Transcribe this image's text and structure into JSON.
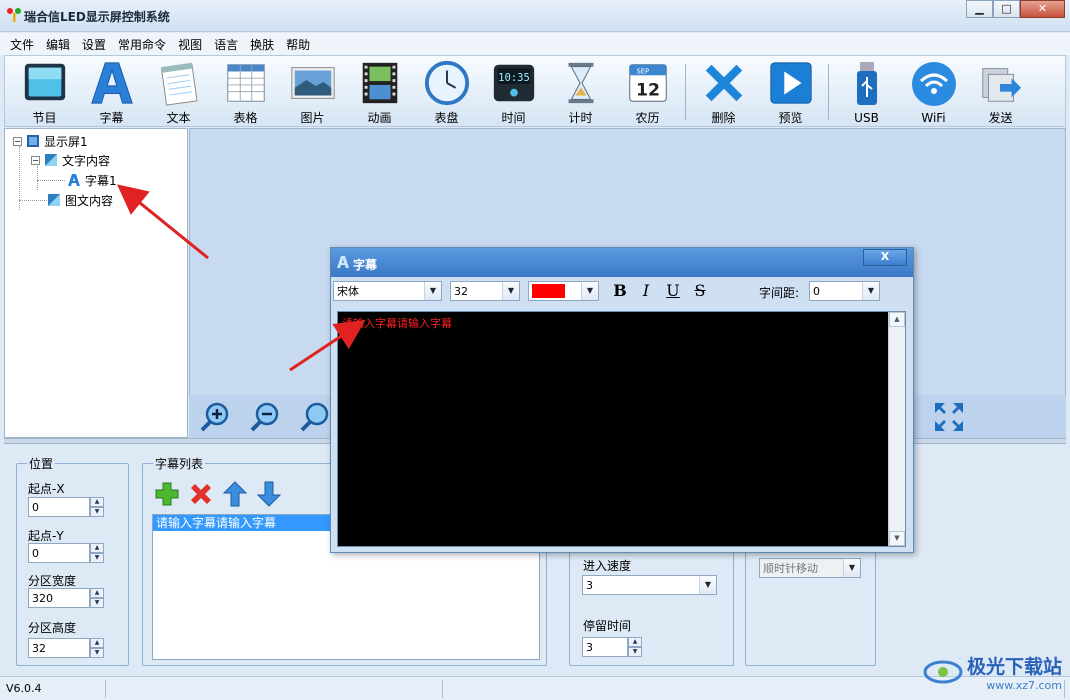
{
  "window": {
    "title": "瑞合信LED显示屏控制系统",
    "min": "▁",
    "max": "□",
    "close": "✕"
  },
  "menu": [
    "文件",
    "编辑",
    "设置",
    "常用命令",
    "视图",
    "语言",
    "换肤",
    "帮助"
  ],
  "toolbar": {
    "program": "节目",
    "subtitle": "字幕",
    "text": "文本",
    "table": "表格",
    "image": "图片",
    "animation": "动画",
    "clock": "表盘",
    "time": "时间",
    "timer": "计时",
    "calendar": "农历",
    "delete": "删除",
    "preview": "预览",
    "usb": "USB",
    "wifi": "WiFi",
    "send": "发送",
    "clock_digits": "10:35",
    "cal_month": "SEP",
    "cal_day": "12"
  },
  "tree": {
    "root": "显示屏1",
    "group1": "文字内容",
    "item1": "字幕1",
    "group2": "图文内容",
    "minus": "−",
    "plus": "+"
  },
  "position": {
    "title": "位置",
    "start_x_label": "起点-X",
    "start_x": "0",
    "start_y_label": "起点-Y",
    "start_y": "0",
    "width_label": "分区宽度",
    "width": "320",
    "height_label": "分区高度",
    "height": "32"
  },
  "subtitle_list": {
    "title": "字幕列表",
    "items": [
      "请输入字幕请输入字幕"
    ]
  },
  "effects": {
    "speed_label": "进入速度",
    "speed": "3",
    "stay_label": "停留时间",
    "stay": "3",
    "direction": "顺时针移动"
  },
  "dialog": {
    "title": "字幕",
    "close": "X",
    "font": "宋体",
    "size": "32",
    "color": "#ff0000",
    "bold": "B",
    "italic": "I",
    "underline": "U",
    "strike": "S",
    "spacing_label": "字间距:",
    "spacing": "0",
    "content": "请输入字幕请输入字幕"
  },
  "status": {
    "version": "V6.0.4"
  },
  "watermark": {
    "name": "极光下载站",
    "url": "www.xz7.com"
  }
}
